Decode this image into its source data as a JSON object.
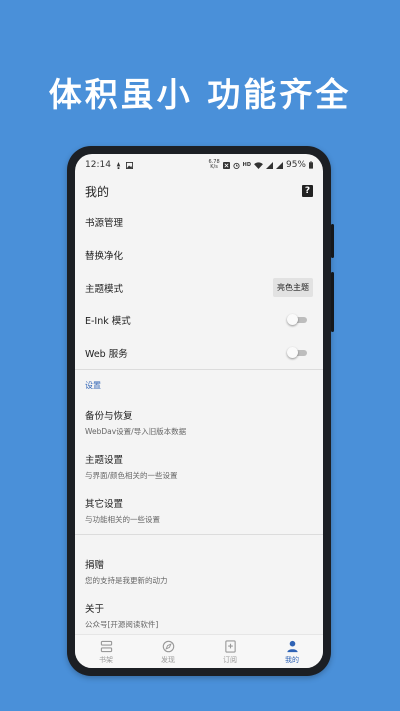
{
  "headline": "体积虽小  功能齐全",
  "status": {
    "time": "12:14",
    "speed_top": "6.78",
    "speed_bottom": "K/s",
    "net_badge": "HD",
    "battery": "95%"
  },
  "title": "我的",
  "menu": [
    {
      "label": "书源管理"
    },
    {
      "label": "替换净化"
    },
    {
      "label": "主题模式",
      "chip": "亮色主题"
    },
    {
      "label": "E-Ink 模式",
      "toggle": false
    },
    {
      "label": "Web 服务",
      "toggle": false
    }
  ],
  "section_title": "设置",
  "settings": [
    {
      "title": "备份与恢复",
      "subtitle": "WebDav设置/导入旧版本数据"
    },
    {
      "title": "主题设置",
      "subtitle": "与界面/颜色相关的一些设置"
    },
    {
      "title": "其它设置",
      "subtitle": "与功能相关的一些设置"
    }
  ],
  "other": [
    {
      "title": "捐赠",
      "subtitle": "您的支持是我更新的动力"
    },
    {
      "title": "关于",
      "subtitle": "公众号[开源阅读软件]"
    }
  ],
  "nav": [
    {
      "label": "书架",
      "icon": "bookshelf-icon",
      "active": false
    },
    {
      "label": "发现",
      "icon": "compass-icon",
      "active": false
    },
    {
      "label": "订阅",
      "icon": "subscription-icon",
      "active": false
    },
    {
      "label": "我的",
      "icon": "person-icon",
      "active": true
    }
  ],
  "colors": {
    "background": "#4a90d9",
    "accent": "#2f63b5",
    "screen": "#f4f4f4"
  }
}
